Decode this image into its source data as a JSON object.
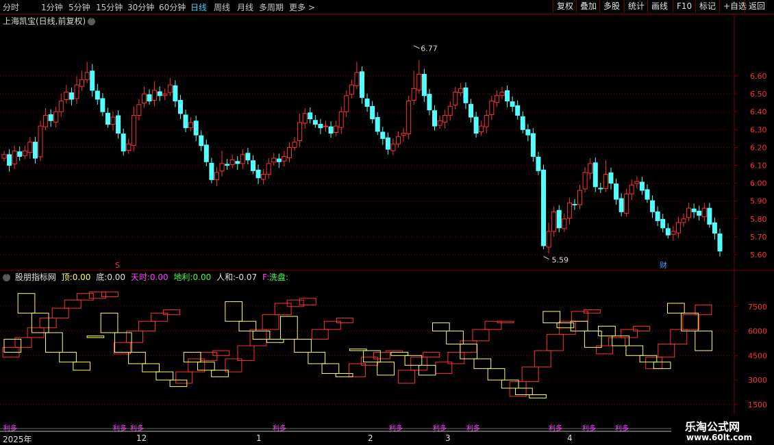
{
  "toolbar": {
    "timeframes": [
      "分时",
      "1分钟",
      "5分钟",
      "15分钟",
      "30分钟",
      "60分钟",
      "日线",
      "周线",
      "月线",
      "多周期",
      "更多 >"
    ],
    "active_index": 6,
    "right_buttons": [
      "复权",
      "叠加",
      "多股",
      "统计",
      "画线",
      "F10",
      "标记",
      "+自选",
      "返回"
    ]
  },
  "main_title": "上海凯宝(日线,前复权)",
  "indicator": {
    "name": "股朋指标网",
    "top_label": "顶:",
    "top_value": "0.00",
    "bottom_label": "底:",
    "bottom_value": "0.00",
    "tianshi_label": "天时:",
    "tianshi_value": "0.00",
    "dili_label": "地利:",
    "dili_value": "0.00",
    "renhe_label": "人和:",
    "renhe_value": "-0.07",
    "f_label": "F:",
    "f_value": "洗盘:"
  },
  "logo": {
    "line1": "乐淘公式网",
    "line2": "www.60lt.com"
  },
  "dates": {
    "year": "2025年",
    "m12": "12",
    "m1": "1",
    "m2": "2",
    "m3": "3",
    "m4": "4"
  },
  "colors": {
    "up": "#ff3232",
    "down": "#54ffff",
    "grid": "#7a0000",
    "yellow": "#ffff66",
    "magenta": "#ff40ff"
  },
  "chart_data": [
    {
      "type": "candlestick",
      "ylim": [
        5.55,
        6.88
      ],
      "yticks": [
        5.6,
        5.7,
        5.8,
        5.9,
        6.0,
        6.1,
        6.2,
        6.3,
        6.4,
        6.5,
        6.6
      ],
      "annotations": [
        {
          "label": "6.77",
          "value": 6.77
        },
        {
          "label": "5.59",
          "value": 5.59
        }
      ],
      "markers": [
        "S",
        "财"
      ],
      "closes": [
        6.16,
        6.1,
        6.18,
        6.15,
        6.18,
        6.23,
        6.14,
        6.32,
        6.38,
        6.35,
        6.4,
        6.46,
        6.51,
        6.47,
        6.55,
        6.58,
        6.62,
        6.52,
        6.47,
        6.4,
        6.33,
        6.37,
        6.28,
        6.18,
        6.22,
        6.38,
        6.44,
        6.5,
        6.46,
        6.52,
        6.49,
        6.5,
        6.55,
        6.46,
        6.39,
        6.31,
        6.34,
        6.27,
        6.21,
        6.12,
        6.02,
        6.06,
        6.11,
        6.1,
        6.13,
        6.11,
        6.16,
        6.13,
        6.07,
        6.03,
        6.05,
        6.11,
        6.14,
        6.12,
        6.15,
        6.2,
        6.23,
        6.34,
        6.39,
        6.36,
        6.33,
        6.31,
        6.32,
        6.28,
        6.32,
        6.4,
        6.49,
        6.55,
        6.62,
        6.48,
        6.43,
        6.36,
        6.29,
        6.25,
        6.19,
        6.22,
        6.26,
        6.28,
        6.46,
        6.53,
        6.61,
        6.49,
        6.41,
        6.32,
        6.35,
        6.38,
        6.43,
        6.51,
        6.53,
        6.45,
        6.37,
        6.28,
        6.32,
        6.38,
        6.46,
        6.49,
        6.51,
        6.46,
        6.43,
        6.38,
        6.3,
        6.27,
        6.15,
        6.07,
        5.65,
        5.73,
        5.84,
        5.75,
        5.8,
        5.89,
        5.88,
        5.96,
        6.06,
        6.11,
        5.98,
        5.97,
        6.05,
        6.0,
        5.91,
        5.84,
        5.94,
        5.99,
        6.01,
        5.96,
        5.91,
        5.84,
        5.79,
        5.75,
        5.71,
        5.73,
        5.78,
        5.8,
        5.86,
        5.84,
        5.82,
        5.86,
        5.77,
        5.72,
        5.62
      ],
      "highs_plus": [
        0.02,
        0.03,
        0.03,
        0.03,
        0.03,
        0.03,
        0.03,
        0.03,
        0.04,
        0.03,
        0.03,
        0.04,
        0.04,
        0.03,
        0.05,
        0.05,
        0.06,
        0.04,
        0.04,
        0.03,
        0.03,
        0.03,
        0.03,
        0.03,
        0.03,
        0.05,
        0.03,
        0.04,
        0.03,
        0.05,
        0.03,
        0.03,
        0.04,
        0.03,
        0.03,
        0.03,
        0.03,
        0.03,
        0.03,
        0.03,
        0.03,
        0.03,
        0.07,
        0.03,
        0.03,
        0.03,
        0.03,
        0.03,
        0.03,
        0.03,
        0.03,
        0.03,
        0.03,
        0.03,
        0.03,
        0.03,
        0.03,
        0.05,
        0.03,
        0.03,
        0.03,
        0.03,
        0.03,
        0.03,
        0.03,
        0.03,
        0.03,
        0.03,
        0.06,
        0.03,
        0.03,
        0.03,
        0.03,
        0.03,
        0.03,
        0.03,
        0.03,
        0.03,
        0.03,
        0.1,
        0.08,
        0.03,
        0.03,
        0.03,
        0.03,
        0.03,
        0.03,
        0.03,
        0.03,
        0.03,
        0.03,
        0.03,
        0.03,
        0.03,
        0.03,
        0.03,
        0.03,
        0.03,
        0.03,
        0.03,
        0.03,
        0.03,
        0.03,
        0.03,
        0.03,
        0.05,
        0.03,
        0.03,
        0.03,
        0.03,
        0.03,
        0.03,
        0.03,
        0.03,
        0.03,
        0.03,
        0.08,
        0.03,
        0.03,
        0.03,
        0.03,
        0.03,
        0.03,
        0.03,
        0.03,
        0.03,
        0.03,
        0.03,
        0.03,
        0.03,
        0.03,
        0.03,
        0.03,
        0.03,
        0.03,
        0.03,
        0.03,
        0.03,
        0.03
      ]
    },
    {
      "type": "step",
      "ylim": [
        1200,
        9000
      ],
      "yticks": [
        1500,
        3000,
        4500,
        6000,
        7500
      ],
      "red_blocks": [
        [
          4400,
          5000
        ],
        [
          5000,
          5600
        ],
        [
          5600,
          6200
        ],
        [
          6200,
          6800
        ],
        [
          6800,
          7400
        ],
        [
          7400,
          7900
        ],
        [
          7900,
          8300
        ],
        [
          8000,
          8400
        ],
        [
          8100,
          8400
        ],
        [
          4600,
          5300
        ],
        [
          5300,
          6000
        ],
        [
          6000,
          6600
        ],
        [
          6600,
          7100
        ],
        [
          7000,
          7300
        ],
        [
          2800,
          3500
        ],
        [
          3500,
          4300
        ],
        [
          4200,
          4700
        ],
        [
          4500,
          4800
        ],
        [
          3500,
          4300
        ],
        [
          4200,
          5100
        ],
        [
          5100,
          6100
        ],
        [
          6100,
          7000
        ],
        [
          7000,
          7700
        ],
        [
          7500,
          7900
        ],
        [
          7600,
          8000
        ],
        [
          5500,
          6100
        ],
        [
          6100,
          6600
        ],
        [
          6500,
          6800
        ],
        [
          3200,
          4000
        ],
        [
          3900,
          4400
        ],
        [
          4300,
          4700
        ],
        [
          4700,
          4800
        ],
        [
          2800,
          3600
        ],
        [
          3600,
          4400
        ],
        [
          4400,
          4700
        ],
        [
          3400,
          4100
        ],
        [
          4000,
          4700
        ],
        [
          4700,
          5400
        ],
        [
          5400,
          6100
        ],
        [
          6100,
          6600
        ],
        [
          6500,
          6600
        ],
        [
          2000,
          2900
        ],
        [
          2900,
          3800
        ],
        [
          3800,
          4800
        ],
        [
          4800,
          5800
        ],
        [
          5800,
          6600
        ],
        [
          6600,
          7200
        ],
        [
          7100,
          7300
        ],
        [
          4600,
          5100
        ],
        [
          5100,
          5600
        ],
        [
          5600,
          6100
        ],
        [
          6000,
          6300
        ],
        [
          3700,
          4400
        ],
        [
          4400,
          5200
        ],
        [
          5200,
          6100
        ],
        [
          6100,
          7000
        ],
        [
          7000,
          7600
        ]
      ],
      "yellow_blocks": [
        [
          4700,
          5500
        ],
        [
          7100,
          8300
        ],
        [
          5900,
          7100
        ],
        [
          4700,
          5900
        ],
        [
          4100,
          4700
        ],
        [
          3600,
          4100
        ],
        [
          5600,
          5700
        ],
        [
          5900,
          7100
        ],
        [
          4700,
          5900
        ],
        [
          4000,
          4700
        ],
        [
          3500,
          4000
        ],
        [
          3000,
          3500
        ],
        [
          2600,
          3000
        ],
        [
          4100,
          4700
        ],
        [
          3600,
          4100
        ],
        [
          3200,
          3600
        ],
        [
          6600,
          7800
        ],
        [
          6000,
          6600
        ],
        [
          5500,
          6000
        ],
        [
          5300,
          5500
        ],
        [
          5500,
          6900
        ],
        [
          4700,
          5500
        ],
        [
          4000,
          4700
        ],
        [
          3400,
          4000
        ],
        [
          3200,
          3400
        ],
        [
          4800,
          4900
        ],
        [
          4100,
          4800
        ],
        [
          3300,
          4100
        ],
        [
          4500,
          4700
        ],
        [
          3900,
          4500
        ],
        [
          3300,
          3900
        ],
        [
          6000,
          6500
        ],
        [
          5200,
          6000
        ],
        [
          4300,
          5200
        ],
        [
          3700,
          4300
        ],
        [
          3000,
          3700
        ],
        [
          2500,
          3000
        ],
        [
          2100,
          2500
        ],
        [
          1900,
          2100
        ],
        [
          6500,
          7200
        ],
        [
          6200,
          6500
        ],
        [
          6000,
          6600
        ],
        [
          5000,
          6000
        ],
        [
          5700,
          6300
        ],
        [
          5100,
          5700
        ],
        [
          4500,
          5100
        ],
        [
          4100,
          4500
        ],
        [
          3700,
          4100
        ],
        [
          7100,
          7700
        ],
        [
          6000,
          7100
        ],
        [
          4800,
          6000
        ]
      ],
      "bottom_labels": [
        "利多",
        "利多",
        "利多",
        "利多",
        "利多",
        "利多",
        "利多",
        "利多",
        "利多",
        "利多"
      ]
    }
  ]
}
